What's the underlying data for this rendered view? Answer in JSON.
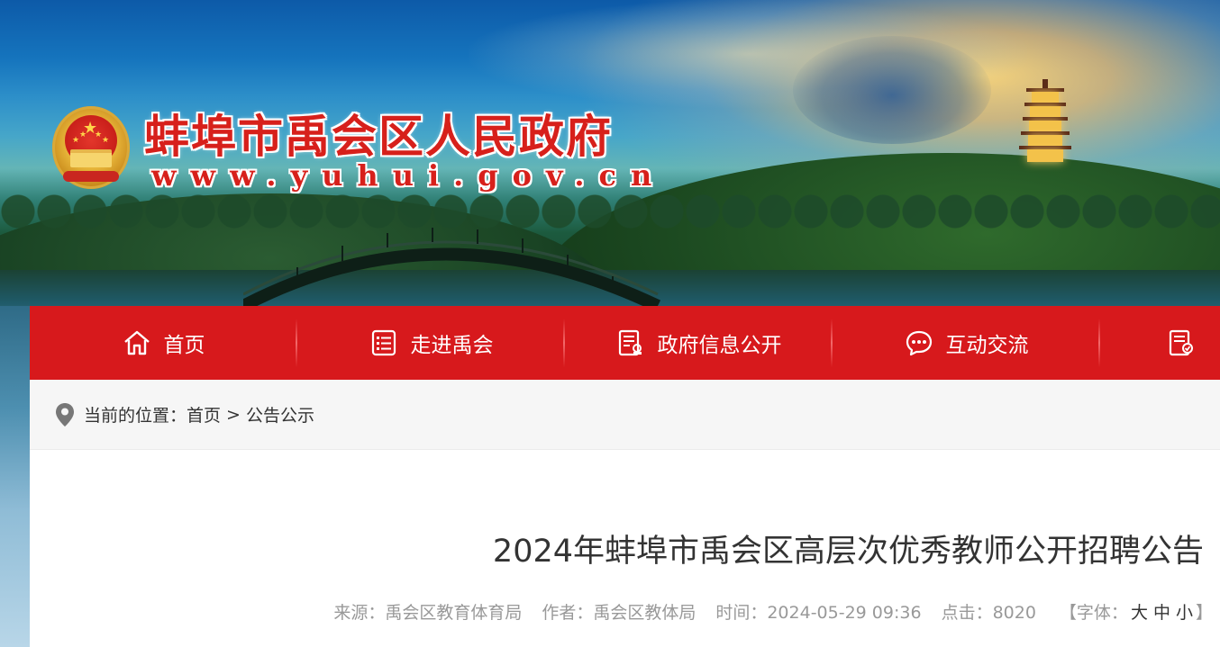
{
  "header": {
    "site_title": "蚌埠市禹会区人民政府",
    "site_url": "www.yuhui.gov.cn"
  },
  "nav": {
    "items": [
      {
        "label": "首页",
        "icon": "home-icon"
      },
      {
        "label": "走进禹会",
        "icon": "list-icon"
      },
      {
        "label": "政府信息公开",
        "icon": "document-icon"
      },
      {
        "label": "互动交流",
        "icon": "chat-icon"
      },
      {
        "label": "",
        "icon": "service-document-icon"
      }
    ]
  },
  "breadcrumb": {
    "prefix": "当前的位置：",
    "home": "首页",
    "separator": ">",
    "current": "公告公示"
  },
  "article": {
    "title": "2024年蚌埠市禹会区高层次优秀教师公开招聘公告",
    "meta": {
      "source": "来源：禹会区教育体育局",
      "author": "作者：禹会区教体局",
      "time": "时间：2024-05-29 09:36",
      "clicks": "点击：8020",
      "font_label_open": "【字体：",
      "font_large": "大",
      "font_medium": "中",
      "font_small": "小",
      "font_label_close": "】"
    }
  },
  "colors": {
    "nav_red": "#d7191c",
    "title_red": "#d7201b",
    "crumb_bg": "#f6f6f6"
  }
}
